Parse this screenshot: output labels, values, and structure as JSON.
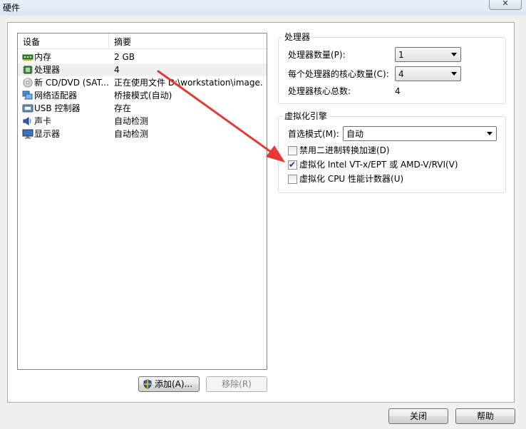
{
  "window": {
    "title": "硬件",
    "close_glyph": "✕"
  },
  "device_list": {
    "headers": {
      "device": "设备",
      "summary": "摘要"
    },
    "rows": [
      {
        "name": "内存",
        "summary": "2 GB",
        "icon": "memory-icon"
      },
      {
        "name": "处理器",
        "summary": "4",
        "icon": "processor-icon"
      },
      {
        "name": "新 CD/DVD (SAT...",
        "summary": "正在使用文件 D:\\workstation\\image...",
        "icon": "cd-dvd-icon"
      },
      {
        "name": "网络适配器",
        "summary": "桥接模式(自动)",
        "icon": "network-adapter-icon"
      },
      {
        "name": "USB 控制器",
        "summary": "存在",
        "icon": "usb-icon"
      },
      {
        "name": "声卡",
        "summary": "自动检测",
        "icon": "sound-card-icon"
      },
      {
        "name": "显示器",
        "summary": "自动检测",
        "icon": "display-icon"
      }
    ],
    "selected_index": 1
  },
  "buttons": {
    "add": "添加(A)...",
    "remove": "移除(R)",
    "close": "关闭",
    "help": "帮助"
  },
  "processor_group": {
    "title": "处理器",
    "num_processors_label": "处理器数量(P):",
    "num_processors_value": "1",
    "cores_per_processor_label": "每个处理器的核心数量(C):",
    "cores_per_processor_value": "4",
    "total_cores_label": "处理器核心总数:",
    "total_cores_value": "4"
  },
  "virtualization_group": {
    "title": "虚拟化引擎",
    "preferred_mode_label": "首选模式(M):",
    "preferred_mode_value": "自动",
    "options": [
      {
        "label": "禁用二进制转换加速(D)",
        "checked": false
      },
      {
        "label": "虚拟化 Intel VT-x/EPT 或 AMD-V/RVI(V)",
        "checked": true
      },
      {
        "label": "虚拟化 CPU 性能计数器(U)",
        "checked": false
      }
    ]
  },
  "colors": {
    "annotation_arrow": "#e53935",
    "check_mark": "#1d3a87"
  }
}
